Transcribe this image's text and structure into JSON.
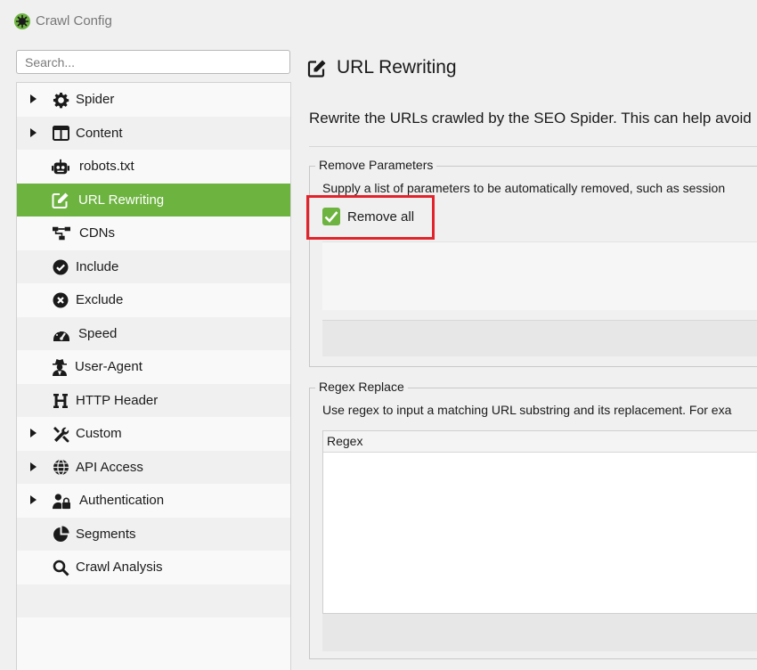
{
  "window": {
    "title": "Crawl Config"
  },
  "search": {
    "placeholder": "Search..."
  },
  "sidebar": {
    "items": [
      {
        "label": "Spider",
        "icon": "gear-icon",
        "expandable": true
      },
      {
        "label": "Content",
        "icon": "columns-icon",
        "expandable": true
      },
      {
        "label": "robots.txt",
        "icon": "robot-icon",
        "expandable": false
      },
      {
        "label": "URL Rewriting",
        "icon": "edit-icon",
        "expandable": false,
        "selected": true
      },
      {
        "label": "CDNs",
        "icon": "network-icon",
        "expandable": false
      },
      {
        "label": "Include",
        "icon": "check-circle-icon",
        "expandable": false
      },
      {
        "label": "Exclude",
        "icon": "x-circle-icon",
        "expandable": false
      },
      {
        "label": "Speed",
        "icon": "speedometer-icon",
        "expandable": false
      },
      {
        "label": "User-Agent",
        "icon": "user-secret-icon",
        "expandable": false
      },
      {
        "label": "HTTP Header",
        "icon": "heading-icon",
        "expandable": false
      },
      {
        "label": "Custom",
        "icon": "tools-icon",
        "expandable": true
      },
      {
        "label": "API Access",
        "icon": "globe-icon",
        "expandable": true
      },
      {
        "label": "Authentication",
        "icon": "user-lock-icon",
        "expandable": true
      },
      {
        "label": "Segments",
        "icon": "pie-chart-icon",
        "expandable": false
      },
      {
        "label": "Crawl Analysis",
        "icon": "search-icon",
        "expandable": false
      }
    ]
  },
  "main": {
    "title": "URL Rewriting",
    "description": "Rewrite the URLs crawled by the SEO Spider. This can help avoid",
    "remove_parameters": {
      "title": "Remove Parameters",
      "description": "Supply a list of parameters to be automatically removed, such as session",
      "remove_all_label": "Remove all",
      "remove_all_checked": true
    },
    "regex_replace": {
      "title": "Regex Replace",
      "description": "Use regex to input a matching URL substring and its replacement. For exa",
      "column_header": "Regex"
    }
  },
  "colors": {
    "accent": "#6db33f",
    "highlight": "#e3232b"
  }
}
